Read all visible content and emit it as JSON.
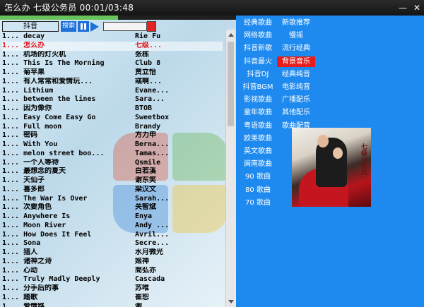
{
  "titlebar": {
    "title": "怎么办  七级公务员  00:01/03:48"
  },
  "controls": {
    "search_value": "抖音",
    "search_label": "搜索",
    "seek_fraction": 0.5,
    "volume_fraction": 0.6
  },
  "colors": {
    "panel_blue": "#1e8aef",
    "accent_red": "#e51d1d",
    "progress_green": "#68c35a",
    "active_song": "#e0141b"
  },
  "icons": [
    "minimize-icon",
    "close-icon",
    "pause-icon",
    "play-icon",
    "scroll-up-icon",
    "scroll-down-icon"
  ],
  "songs": [
    {
      "title": "1... decay",
      "artist": "Rie Fu",
      "active": false
    },
    {
      "title": "1... 怎么办",
      "artist": "七级...",
      "active": true
    },
    {
      "title": "1... 机场的灯火机",
      "artist": "张栋",
      "active": false
    },
    {
      "title": "1... This Is The Morning",
      "artist": "Club 8",
      "active": false
    },
    {
      "title": "1... 菊苹果",
      "artist": "贾立怡",
      "active": false
    },
    {
      "title": "1... 有人常常和爱情玩...",
      "artist": "彧啊...",
      "active": false
    },
    {
      "title": "1... Lithium",
      "artist": "Evane...",
      "active": false
    },
    {
      "title": "1... between the lines",
      "artist": "Sara...",
      "active": false
    },
    {
      "title": "1... 因为像你",
      "artist": "BTOB",
      "active": false
    },
    {
      "title": "1... Easy Come Easy Go",
      "artist": "Sweetbox",
      "active": false
    },
    {
      "title": "1... Full moon",
      "artist": "Brandy",
      "active": false
    },
    {
      "title": "1... 密码",
      "artist": "方力申",
      "active": false
    },
    {
      "title": "1... With You",
      "artist": "Berna...",
      "active": false
    },
    {
      "title": "1... melon street boo...",
      "artist": "Tamas...",
      "active": false
    },
    {
      "title": "1... 一个人等待",
      "artist": "Qsmile",
      "active": false
    },
    {
      "title": "1... 最想念的夏天",
      "artist": "白若溪",
      "active": false
    },
    {
      "title": "1... 天仙子",
      "artist": "谢东笑",
      "active": false
    },
    {
      "title": "1... 喜多郎",
      "artist": "梁汉文",
      "active": false
    },
    {
      "title": "1... The War Is Over",
      "artist": "Sarah...",
      "active": false
    },
    {
      "title": "1... 次要角色",
      "artist": "关智斌",
      "active": false
    },
    {
      "title": "1... Anywhere Is",
      "artist": "Enya",
      "active": false
    },
    {
      "title": "1... Moon River",
      "artist": "Andy ...",
      "active": false
    },
    {
      "title": "1... How Does It Feel",
      "artist": "Avril...",
      "active": false
    },
    {
      "title": "1... Sona",
      "artist": "Secre...",
      "active": false
    },
    {
      "title": "1... 猎人",
      "artist": "水月微光",
      "active": false
    },
    {
      "title": "1... 诸神之诗",
      "artist": "姬神",
      "active": false
    },
    {
      "title": "1... 心动",
      "artist": "简弘亦",
      "active": false
    },
    {
      "title": "1... Truly Madly Deeply",
      "artist": "Cascada",
      "active": false
    },
    {
      "title": "1... 分手后的事",
      "artist": "苏唯",
      "active": false
    },
    {
      "title": "1... 踏歌",
      "artist": "崔恕",
      "active": false
    },
    {
      "title": "1... 爱情路",
      "artist": "谢...",
      "active": false
    }
  ],
  "categories": {
    "col1": [
      "经典歌曲",
      "网络歌曲",
      "抖音新歌",
      "抖音最火",
      "抖音DJ",
      "抖音BGM",
      "影视歌曲",
      "童年歌曲",
      "粤语歌曲",
      "欧美歌曲",
      "英文歌曲",
      "闽南歌曲",
      "90 歌曲",
      "80 歌曲",
      "70 歌曲"
    ],
    "col2": [
      "新歌推荐",
      "慢摇",
      "流行经典",
      "背景音乐",
      "经典纯音",
      "电影纯音",
      "广播配乐",
      "其他配乐",
      "歌曲配音"
    ]
  },
  "album_cover": {
    "caption": "七级公务员"
  }
}
